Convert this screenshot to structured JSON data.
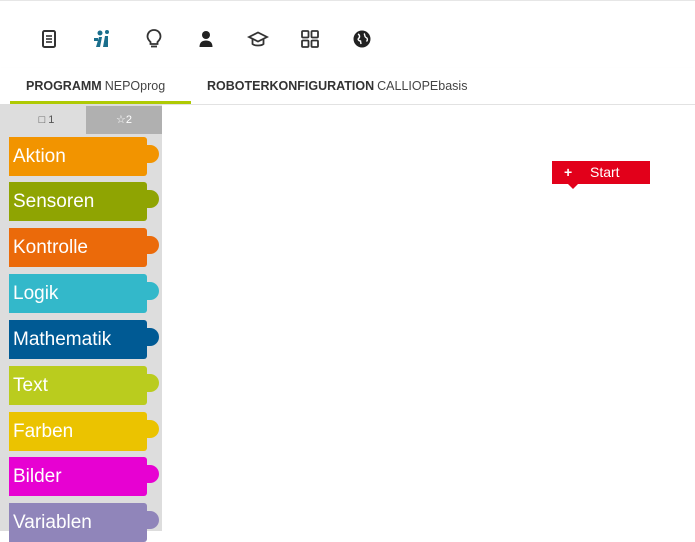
{
  "menu": {
    "icons": [
      {
        "name": "program-icon",
        "color": "#333333"
      },
      {
        "name": "robot-icon",
        "color": "#1a6e8c"
      },
      {
        "name": "help-icon",
        "color": "#333333"
      },
      {
        "name": "user-icon",
        "color": "#333333"
      },
      {
        "name": "gallery-icon",
        "color": "#333333"
      },
      {
        "name": "tutorial-icon",
        "color": "#333333"
      },
      {
        "name": "language-icon",
        "color": "#333333"
      }
    ]
  },
  "tabs": {
    "program": {
      "label": "PROGRAMM",
      "name": "NEPOprog"
    },
    "config": {
      "label": "ROBOTERKONFIGURATION",
      "name": "CALLIOPEbasis"
    }
  },
  "toolbox": {
    "level1": "1",
    "level2": "2",
    "categories": [
      {
        "label": "Aktion",
        "color": "#f29400"
      },
      {
        "label": "Sensoren",
        "color": "#8fa402"
      },
      {
        "label": "Kontrolle",
        "color": "#eb6a0a"
      },
      {
        "label": "Logik",
        "color": "#33b8ca"
      },
      {
        "label": "Mathematik",
        "color": "#005a94"
      },
      {
        "label": "Text",
        "color": "#bacc1e"
      },
      {
        "label": "Farben",
        "color": "#ebc300"
      },
      {
        "label": "Bilder",
        "color": "#e701d2"
      },
      {
        "label": "Variablen",
        "color": "#9085ba"
      }
    ]
  },
  "workspace": {
    "start_label": "Start",
    "start_plus": "+",
    "start_color": "#e2001a"
  }
}
